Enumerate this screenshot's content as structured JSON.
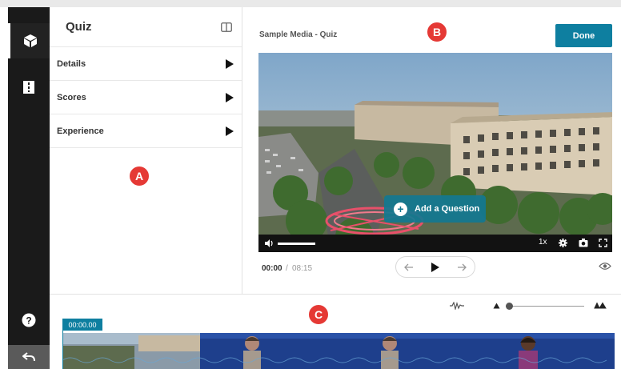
{
  "panel_a": {
    "title": "Quiz",
    "badge": "A",
    "items": [
      {
        "label": "Details"
      },
      {
        "label": "Scores"
      },
      {
        "label": "Experience"
      }
    ]
  },
  "panel_b": {
    "title": "Sample Media - Quiz",
    "badge": "B",
    "done_label": "Done",
    "add_question_label": "Add a Question",
    "current_time": "00:00",
    "time_separator": "/",
    "total_time": "08:15",
    "speed": "1x"
  },
  "panel_c": {
    "badge": "C",
    "timestamp": "00:00.00"
  },
  "colors": {
    "accent": "#0e7fa0",
    "badge": "#e53935",
    "rail": "#1a1a1a",
    "filmstrip": "#1d3d85"
  }
}
